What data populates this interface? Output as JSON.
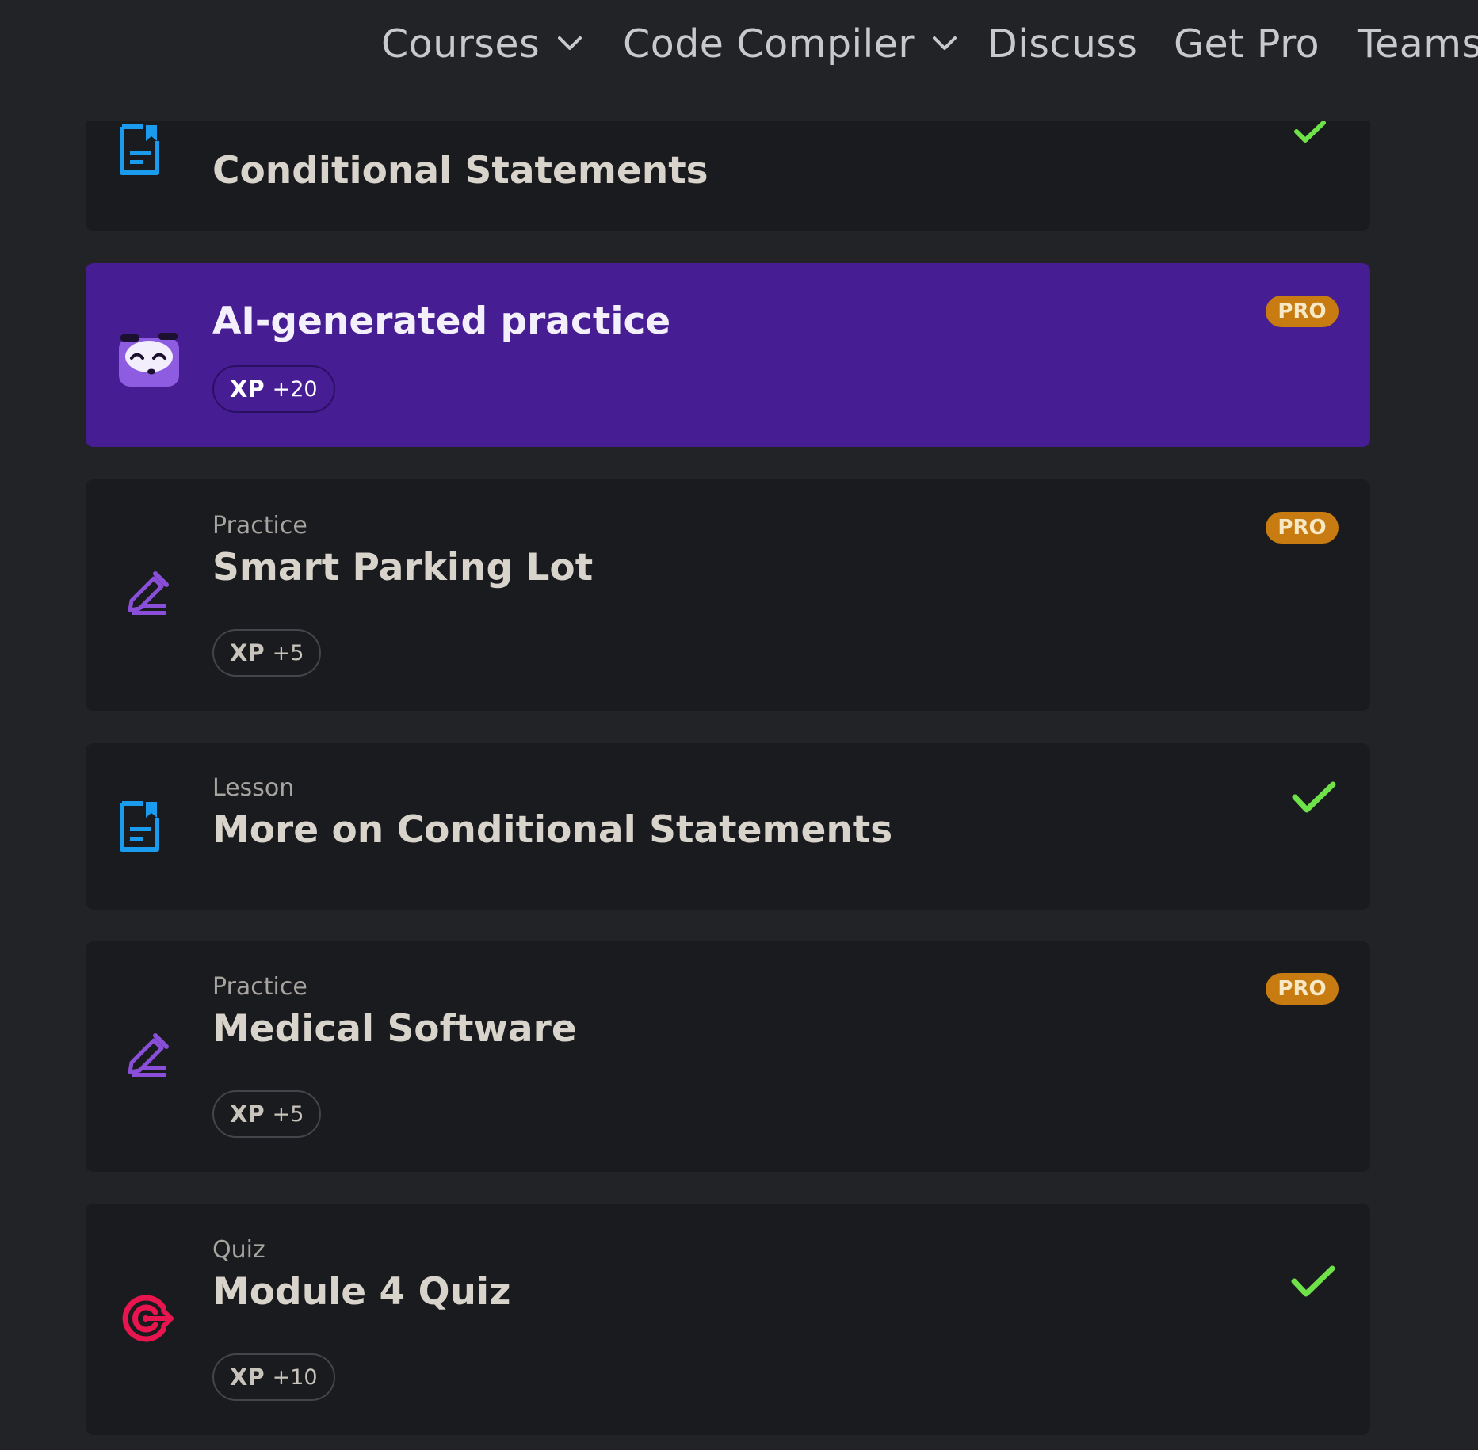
{
  "nav": {
    "courses": "Courses",
    "code_compiler": "Code Compiler",
    "discuss": "Discuss",
    "get_pro": "Get Pro",
    "teams": "Teams"
  },
  "cards": [
    {
      "type": "",
      "title": "Conditional Statements",
      "icon": "lesson-doc-icon",
      "completed": true
    },
    {
      "type": "",
      "title": "AI-generated practice",
      "icon": "ai-mascot-icon",
      "badge": "PRO",
      "xp_label": "XP",
      "xp_value": "+20"
    },
    {
      "type": "Practice",
      "title": "Smart Parking Lot",
      "icon": "pencil-edit-icon",
      "badge": "PRO",
      "xp_label": "XP",
      "xp_value": "+5"
    },
    {
      "type": "Lesson",
      "title": "More on Conditional Statements",
      "icon": "lesson-doc-icon",
      "completed": true
    },
    {
      "type": "Practice",
      "title": "Medical Software",
      "icon": "pencil-edit-icon",
      "badge": "PRO",
      "xp_label": "XP",
      "xp_value": "+5"
    },
    {
      "type": "Quiz",
      "title": "Module 4 Quiz",
      "icon": "target-icon",
      "completed": true,
      "xp_label": "XP",
      "xp_value": "+10"
    }
  ],
  "colors": {
    "background": "#222327",
    "card": "#1a1b1e",
    "ai_card": "#461d93",
    "pro_badge": "#c77b10",
    "check": "#6fe24a",
    "lesson_icon": "#1a9bee",
    "practice_icon": "#8a4fd8",
    "quiz_icon": "#e8154f"
  }
}
